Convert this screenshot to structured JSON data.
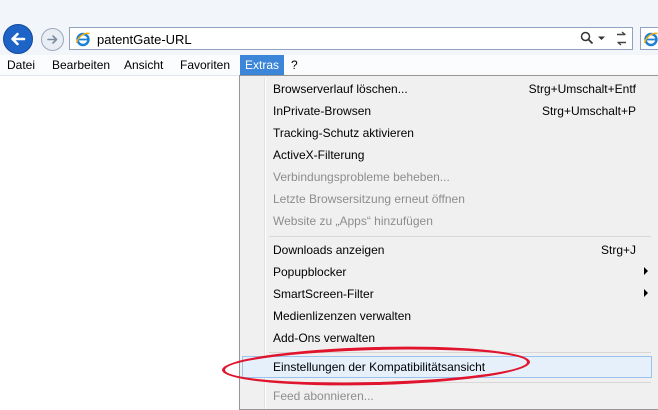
{
  "address_bar": {
    "url": "patentGate-URL"
  },
  "menubar": {
    "items": [
      "Datei",
      "Bearbeiten",
      "Ansicht",
      "Favoriten",
      "Extras",
      "?"
    ],
    "active": "Extras"
  },
  "dropdown": {
    "items": [
      {
        "label": "Browserverlauf löschen...",
        "shortcut": "Strg+Umschalt+Entf",
        "state": "enabled"
      },
      {
        "label": "InPrivate-Browsen",
        "shortcut": "Strg+Umschalt+P",
        "state": "enabled"
      },
      {
        "label": "Tracking-Schutz aktivieren",
        "shortcut": "",
        "state": "enabled"
      },
      {
        "label": "ActiveX-Filterung",
        "shortcut": "",
        "state": "enabled"
      },
      {
        "label": "Verbindungsprobleme beheben...",
        "shortcut": "",
        "state": "disabled"
      },
      {
        "label": "Letzte Browsersitzung erneut öffnen",
        "shortcut": "",
        "state": "disabled"
      },
      {
        "label": "Website zu „Apps“ hinzufügen",
        "shortcut": "",
        "state": "disabled"
      },
      {
        "label": "Downloads anzeigen",
        "shortcut": "Strg+J",
        "state": "enabled"
      },
      {
        "label": "Popupblocker",
        "shortcut": "",
        "state": "submenu"
      },
      {
        "label": "SmartScreen-Filter",
        "shortcut": "",
        "state": "submenu"
      },
      {
        "label": "Medienlizenzen verwalten",
        "shortcut": "",
        "state": "enabled"
      },
      {
        "label": "Add-Ons verwalten",
        "shortcut": "",
        "state": "enabled"
      },
      {
        "label": "Einstellungen der Kompatibilitätsansicht",
        "shortcut": "",
        "state": "highlighted"
      },
      {
        "label": "Feed abonnieren...",
        "shortcut": "",
        "state": "disabled"
      }
    ]
  },
  "colors": {
    "menu_active": "#3b86d9",
    "highlight_bg": "#e5f0fb",
    "annotation_red": "#e0142d",
    "back_button": "#1e63c6"
  },
  "icons": {
    "back": "arrow-left-icon",
    "forward": "arrow-right-icon",
    "page": "ie-logo-icon",
    "search": "magnifier-icon",
    "dropdown": "chevron-down-icon",
    "refresh": "refresh-icon"
  }
}
